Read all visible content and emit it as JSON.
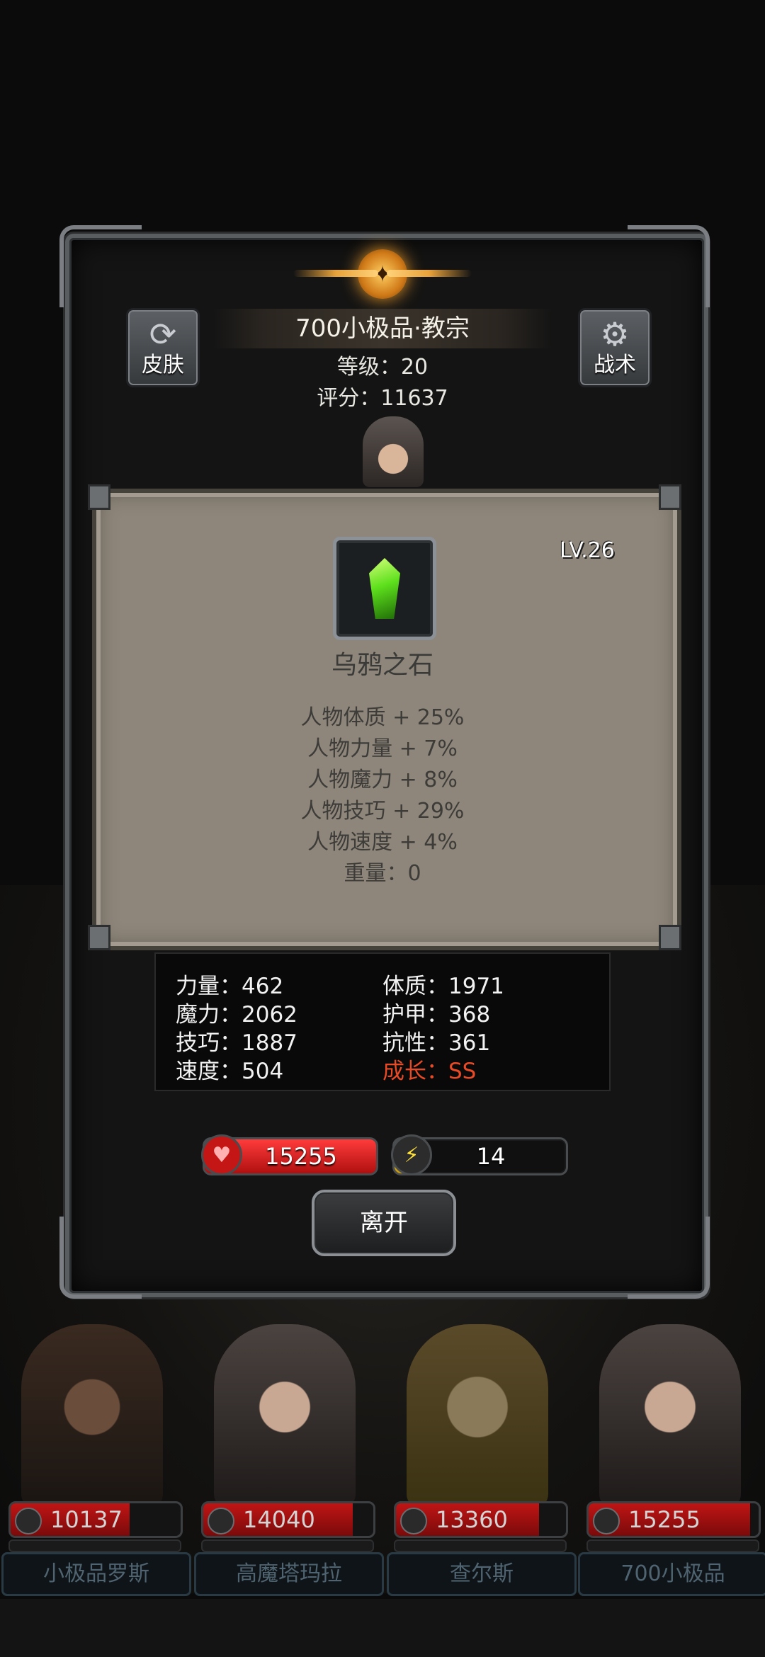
{
  "hero": {
    "title": "700小极品·教宗",
    "level_text": "等级：20",
    "score_text": "评分：11637"
  },
  "buttons": {
    "skin_label": "皮肤",
    "tactics_label": "战术",
    "leave_label": "离开"
  },
  "item": {
    "level": "LV.26",
    "name": "乌鸦之石",
    "attributes": [
      "人物体质 + 25%",
      "人物力量 + 7%",
      "人物魔力 + 8%",
      "人物技巧 + 29%",
      "人物速度 + 4%",
      "重量：0"
    ]
  },
  "stats": {
    "strength": "力量：462",
    "constitution": "体质：1971",
    "magic": "魔力：2062",
    "armor": "护甲：368",
    "skill": "技巧：1887",
    "resistance": "抗性：361",
    "speed": "速度：504",
    "growth": "成长：SS"
  },
  "bars": {
    "hp": "15255",
    "energy": "14"
  },
  "roster": [
    {
      "hp": "10137",
      "name": "小极品罗斯"
    },
    {
      "hp": "14040",
      "name": "高魔塔玛拉"
    },
    {
      "hp": "13360",
      "name": "查尔斯"
    },
    {
      "hp": "15255",
      "name": "700小极品"
    }
  ],
  "colors": {
    "growth_text": "#e84a26",
    "hp_bar": "#d51c1c",
    "energy_bar": "#e6c020",
    "card_bg": "#8e867a"
  }
}
